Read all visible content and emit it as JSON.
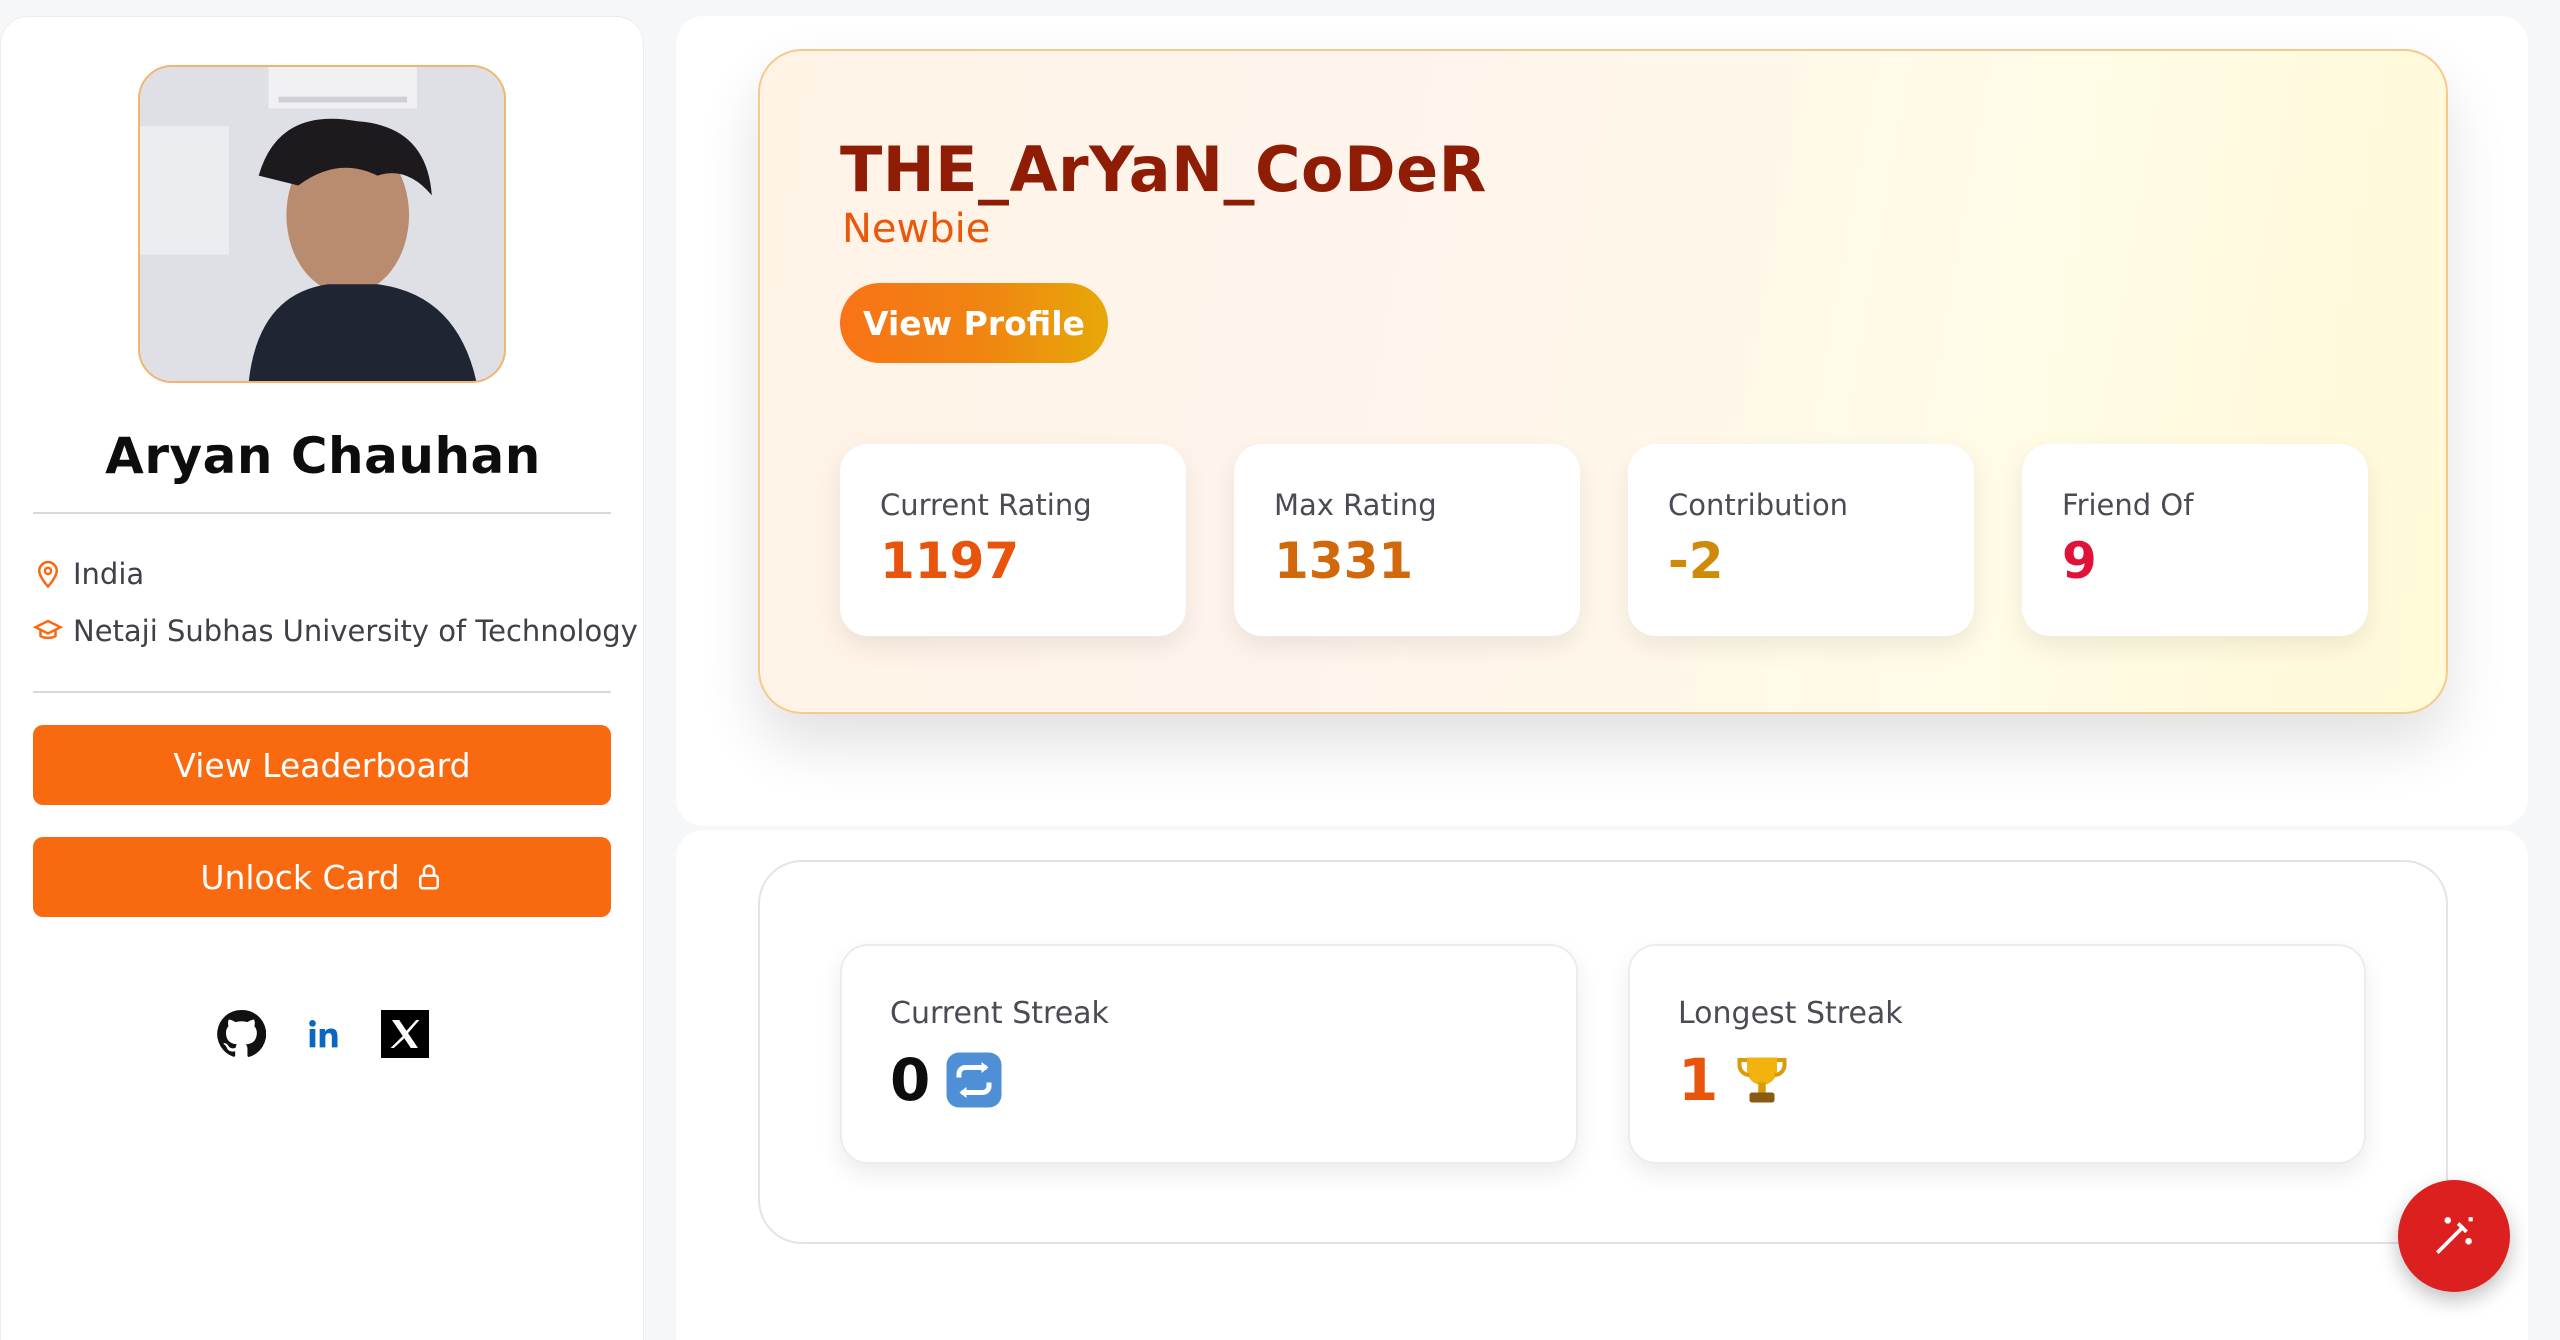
{
  "profile": {
    "display_name": "Aryan Chauhan",
    "country": "India",
    "organization": "Netaji Subhas University of Technology",
    "leaderboard_label": "View Leaderboard",
    "unlock_label": "Unlock Card",
    "socials": [
      "github-icon",
      "linkedin-icon",
      "x-icon"
    ]
  },
  "hero": {
    "handle": "THE_ArYaN_CoDeR",
    "rank": "Newbie",
    "view_profile_label": "View Profile",
    "stats": [
      {
        "label": "Current Rating",
        "value": "1197",
        "color": "#e8540c"
      },
      {
        "label": "Max Rating",
        "value": "1331",
        "color": "#d2680c"
      },
      {
        "label": "Contribution",
        "value": "-2",
        "color": "#d08a0a"
      },
      {
        "label": "Friend Of",
        "value": "9",
        "color": "#e0123a"
      }
    ]
  },
  "streaks": {
    "current": {
      "label": "Current Streak",
      "value": "0",
      "icon": "repeat-emoji-icon"
    },
    "longest": {
      "label": "Longest Streak",
      "value": "1",
      "icon": "trophy-emoji-icon"
    }
  },
  "colors": {
    "accent": "#f96a10",
    "handle": "#8f1d06",
    "fab": "#dc1f1f"
  }
}
